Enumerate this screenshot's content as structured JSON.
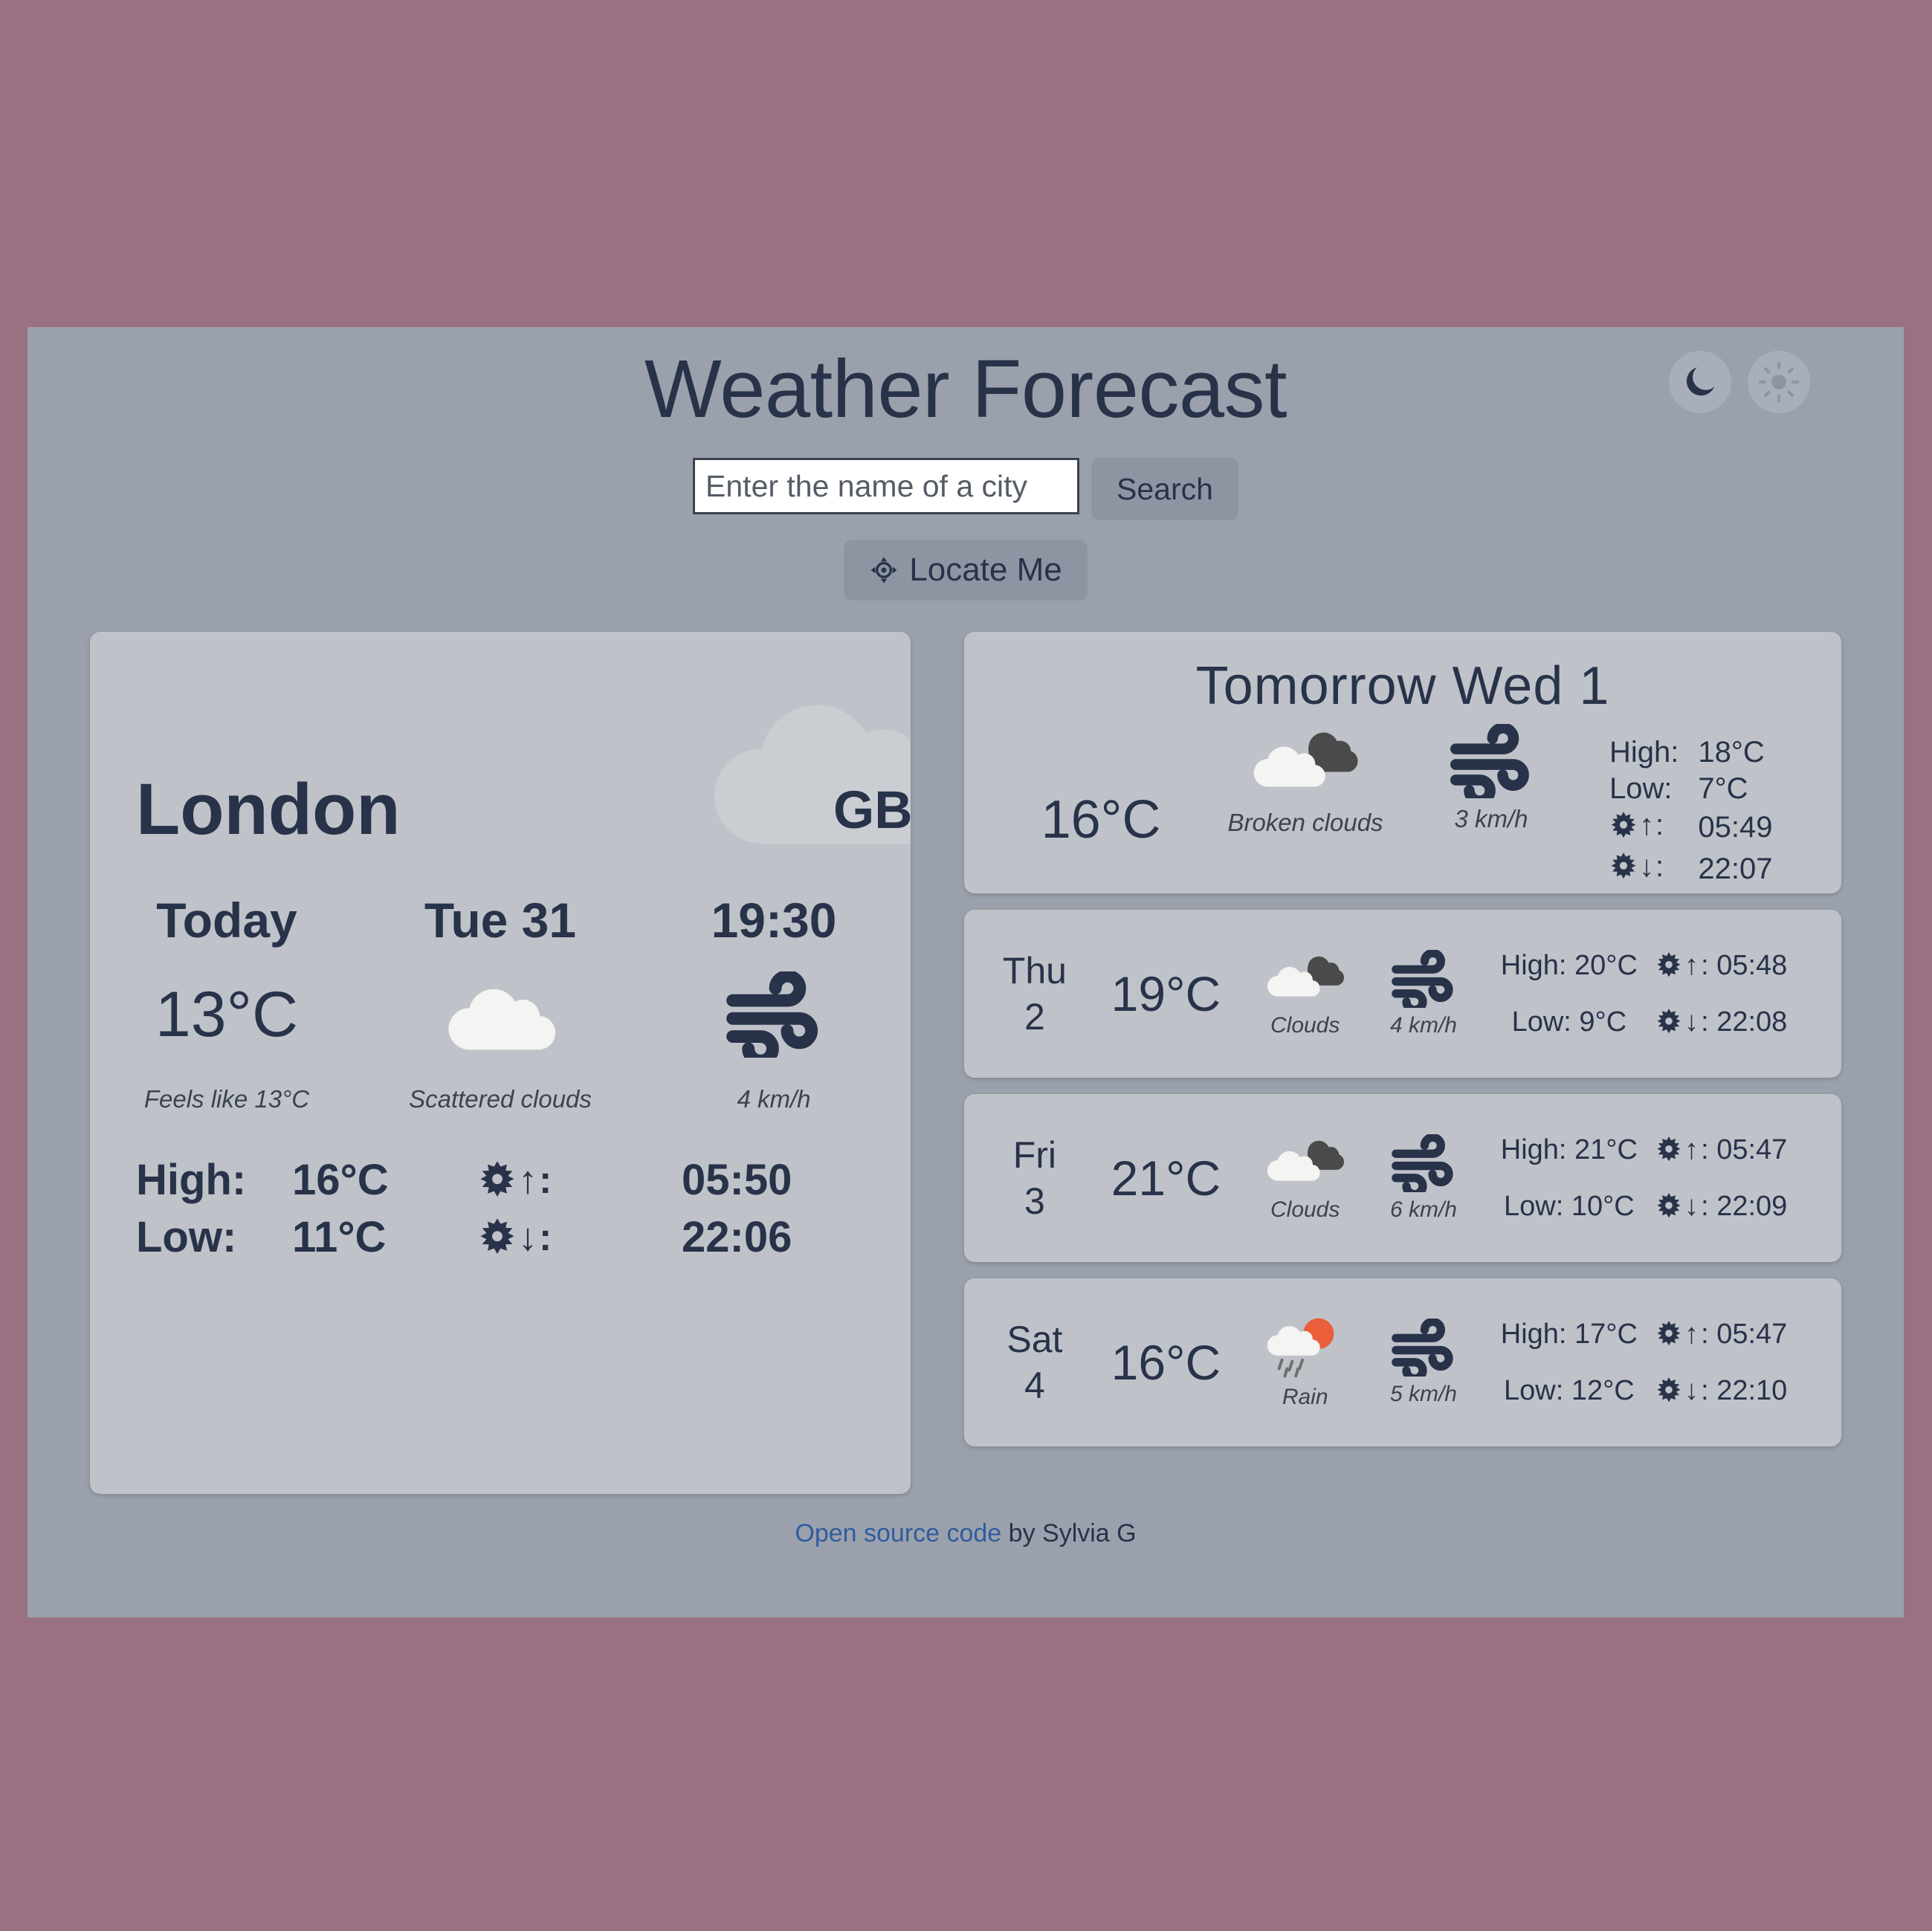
{
  "header": {
    "title": "Weather Forecast",
    "theme_dark_icon": "moon-icon",
    "theme_light_icon": "sun-icon"
  },
  "search": {
    "placeholder": "Enter the name of a city",
    "value": "",
    "button_label": "Search",
    "locate_label": "Locate Me",
    "locate_icon": "crosshair-location-icon"
  },
  "current": {
    "city": "London",
    "country": "GB",
    "day_label": "Today",
    "date_label": "Tue  31",
    "time_label": "19:30",
    "temperature": "13°C",
    "feels_like": "Feels like 13°C",
    "condition": "Scattered clouds",
    "condition_icon": "cloud-icon",
    "wind": "4 km/h",
    "wind_icon": "wind-icon",
    "high_label": "High:",
    "high_value": "16°C",
    "low_label": "Low:",
    "low_value": "11°C",
    "sunrise_label": ":",
    "sunrise_value": "05:50",
    "sunset_label": ":",
    "sunset_value": "22:06"
  },
  "tomorrow": {
    "title": "Tomorrow  Wed  1",
    "temperature": "16°C",
    "condition": "Broken clouds",
    "condition_icon": "broken-clouds-icon",
    "wind": "3 km/h",
    "wind_icon": "wind-icon",
    "high_label": "High:",
    "high_value": "18°C",
    "low_label": "Low:",
    "low_value": "7°C",
    "sunrise_label": ":",
    "sunrise_value": "05:49",
    "sunset_label": ":",
    "sunset_value": "22:07"
  },
  "forecast_days": [
    {
      "weekday": "Thu",
      "daynum": "2",
      "temperature": "19°C",
      "condition": "Clouds",
      "condition_icon": "broken-clouds-icon",
      "wind": "4 km/h",
      "wind_icon": "wind-icon",
      "high": "High: 20°C",
      "low": "Low: 9°C",
      "sunrise": ": 05:48",
      "sunset": ": 22:08"
    },
    {
      "weekday": "Fri",
      "daynum": "3",
      "temperature": "21°C",
      "condition": "Clouds",
      "condition_icon": "broken-clouds-icon",
      "wind": "6 km/h",
      "wind_icon": "wind-icon",
      "high": "High: 21°C",
      "low": "Low: 10°C",
      "sunrise": ": 05:47",
      "sunset": ": 22:09"
    },
    {
      "weekday": "Sat",
      "daynum": "4",
      "temperature": "16°C",
      "condition": "Rain",
      "condition_icon": "rain-sun-icon",
      "wind": "5 km/h",
      "wind_icon": "wind-icon",
      "high": "High: 17°C",
      "low": "Low: 12°C",
      "sunrise": ": 05:47",
      "sunset": ": 22:10"
    }
  ],
  "footer": {
    "link_text": "Open source code",
    "suffix_text": " by Sylvia G"
  },
  "colors": {
    "page_background": "#9a7183",
    "panel_background": "#9ba1ac",
    "card_background": "#bfc3c9",
    "text_primary": "#28334a",
    "button_background": "#8e95a2",
    "link": "#2f5c9e",
    "cloud_white": "#f4f4f2",
    "cloud_dark": "#4a4a4a",
    "sun_orange": "#ea5e3a"
  }
}
